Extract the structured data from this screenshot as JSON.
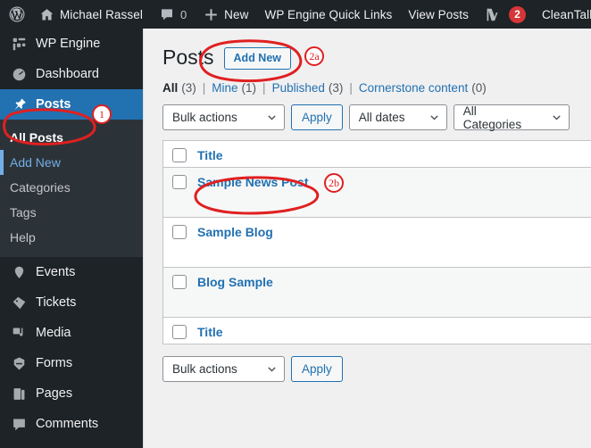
{
  "adminbar": {
    "items": [
      {
        "name": "wordpress-logo",
        "icon": "wordpress-icon",
        "label": ""
      },
      {
        "name": "site-name",
        "icon": "home-icon",
        "label": "Michael Rassel"
      },
      {
        "name": "comments",
        "icon": "comment-bubble-icon",
        "label": "0"
      },
      {
        "name": "new-content",
        "icon": "plus-icon",
        "label": "New"
      },
      {
        "name": "wp-engine-quick-links",
        "icon": "",
        "label": "WP Engine Quick Links"
      },
      {
        "name": "view-posts",
        "icon": "",
        "label": "View Posts"
      },
      {
        "name": "yoast-seo",
        "icon": "yoast-icon",
        "label": "",
        "badge": "2"
      },
      {
        "name": "cleantalk",
        "icon": "",
        "label": "CleanTalk"
      }
    ]
  },
  "sidebar": {
    "items": [
      {
        "label": "WP Engine",
        "icon": "wpengine-icon",
        "state": "normal"
      },
      {
        "label": "Dashboard",
        "icon": "dashboard-icon",
        "state": "normal"
      },
      {
        "label": "Posts",
        "icon": "pin-icon",
        "state": "current"
      },
      {
        "label": "Events",
        "icon": "events-icon",
        "state": "normal"
      },
      {
        "label": "Tickets",
        "icon": "tickets-icon",
        "state": "normal"
      },
      {
        "label": "Media",
        "icon": "media-icon",
        "state": "normal"
      },
      {
        "label": "Forms",
        "icon": "forms-icon",
        "state": "normal"
      },
      {
        "label": "Pages",
        "icon": "pages-icon",
        "state": "normal"
      },
      {
        "label": "Comments",
        "icon": "comments-icon",
        "state": "normal"
      }
    ],
    "submenu": [
      {
        "label": "All Posts",
        "state": "current"
      },
      {
        "label": "Add New",
        "state": "hovered"
      },
      {
        "label": "Categories",
        "state": "normal"
      },
      {
        "label": "Tags",
        "state": "normal"
      },
      {
        "label": "Help",
        "state": "normal"
      }
    ]
  },
  "page": {
    "title": "Posts",
    "add_new_label": "Add New"
  },
  "views": [
    {
      "label": "All",
      "count": "(3)",
      "current": true
    },
    {
      "label": "Mine",
      "count": "(1)",
      "current": false
    },
    {
      "label": "Published",
      "count": "(3)",
      "current": false
    },
    {
      "label": "Cornerstone content",
      "count": "(0)",
      "current": false
    }
  ],
  "views_separator": "|",
  "tablenav_top": {
    "bulk_actions_label": "Bulk actions",
    "apply_label": "Apply",
    "dates_label": "All dates",
    "categories_label": "All Categories"
  },
  "tablenav_bottom": {
    "bulk_actions_label": "Bulk actions",
    "apply_label": "Apply"
  },
  "table": {
    "header_title": "Title",
    "footer_title": "Title",
    "rows": [
      {
        "title": "Sample News Post",
        "alt": true
      },
      {
        "title": "Sample Blog",
        "alt": false
      },
      {
        "title": "Blog Sample",
        "alt": true
      }
    ]
  },
  "annotations": [
    {
      "id": "1",
      "target": "posts-menu-item"
    },
    {
      "id": "2a",
      "target": "add-new-button"
    },
    {
      "id": "2b",
      "target": "sample-news-post-link"
    }
  ],
  "colors": {
    "annotation": "#e02020",
    "admin_bar": "#1d2327",
    "menu_current": "#2271b1",
    "link": "#2271b1",
    "badge": "#d63638"
  }
}
